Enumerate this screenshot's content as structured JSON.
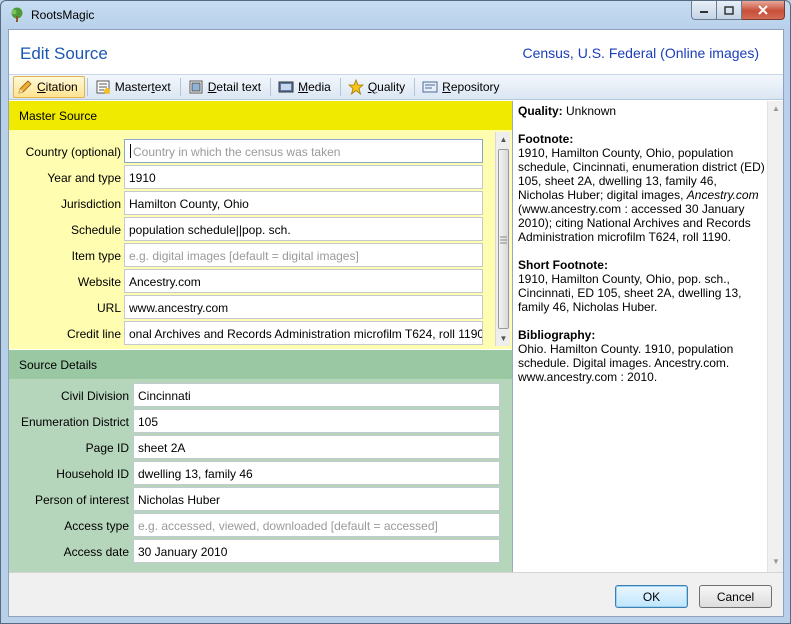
{
  "window": {
    "title": "RootsMagic",
    "min_glyph": "▁",
    "max_glyph": "□",
    "close_glyph": "✕"
  },
  "header": {
    "title": "Edit Source",
    "source_type": "Census, U.S. Federal (Online images)"
  },
  "tabs": [
    {
      "label_ul": "C",
      "label_rest": "itation",
      "icon": "pencil-icon"
    },
    {
      "label_pre": "Master ",
      "label_ul": "t",
      "label_rest": "ext",
      "icon": "note-icon"
    },
    {
      "label_ul": "D",
      "label_rest": "etail text",
      "icon": "detail-note-icon"
    },
    {
      "label_ul": "M",
      "label_rest": "edia",
      "icon": "media-icon"
    },
    {
      "label_ul": "Q",
      "label_rest": "uality",
      "icon": "star-icon"
    },
    {
      "label_ul": "R",
      "label_rest": "epository",
      "icon": "repository-icon"
    }
  ],
  "master_source": {
    "heading": "Master Source",
    "fields": [
      {
        "label": "Country (optional)",
        "value": "",
        "placeholder": "Country in which the census was taken"
      },
      {
        "label": "Year and type",
        "value": "1910",
        "placeholder": ""
      },
      {
        "label": "Jurisdiction",
        "value": "Hamilton County, Ohio",
        "placeholder": ""
      },
      {
        "label": "Schedule",
        "value": "population schedule||pop. sch.",
        "placeholder": ""
      },
      {
        "label": "Item type",
        "value": "",
        "placeholder": "e.g. digital images [default = digital images]"
      },
      {
        "label": "Website",
        "value": "Ancestry.com",
        "placeholder": ""
      },
      {
        "label": "URL",
        "value": "www.ancestry.com",
        "placeholder": ""
      },
      {
        "label": "Credit line",
        "value": "onal Archives and Records Administration microfilm T624, roll 1190",
        "placeholder": ""
      }
    ]
  },
  "source_details": {
    "heading": "Source Details",
    "fields": [
      {
        "label": "Civil Division",
        "value": "Cincinnati",
        "placeholder": ""
      },
      {
        "label": "Enumeration District",
        "value": "105",
        "placeholder": ""
      },
      {
        "label": "Page ID",
        "value": "sheet 2A",
        "placeholder": ""
      },
      {
        "label": "Household ID",
        "value": "dwelling 13, family 46",
        "placeholder": ""
      },
      {
        "label": "Person of interest",
        "value": "Nicholas Huber",
        "placeholder": ""
      },
      {
        "label": "Access type",
        "value": "",
        "placeholder": "e.g. accessed, viewed, downloaded [default = accessed]"
      },
      {
        "label": "Access date",
        "value": "30 January 2010",
        "placeholder": ""
      }
    ]
  },
  "preview": {
    "quality_label": "Quality:",
    "quality_value": "Unknown",
    "footnote_label": "Footnote:",
    "footnote_text_1": "1910, Hamilton County, Ohio, population schedule, Cincinnati, enumeration district (ED) 105, sheet 2A, dwelling 13, family 46, Nicholas Huber; digital images,",
    "footnote_italic": "Ancestry.com",
    "footnote_text_2": "(www.ancestry.com : accessed 30 January 2010); citing National Archives and Records Administration microfilm T624, roll 1190.",
    "short_label": "Short Footnote:",
    "short_text": "1910, Hamilton County, Ohio, pop. sch., Cincinnati, ED 105, sheet 2A, dwelling 13, family 46, Nicholas Huber.",
    "bib_label": "Bibliography:",
    "bib_text": "Ohio. Hamilton County. 1910, population schedule. Digital images. Ancestry.com. www.ancestry.com : 2010."
  },
  "buttons": {
    "ok": "OK",
    "cancel": "Cancel"
  }
}
